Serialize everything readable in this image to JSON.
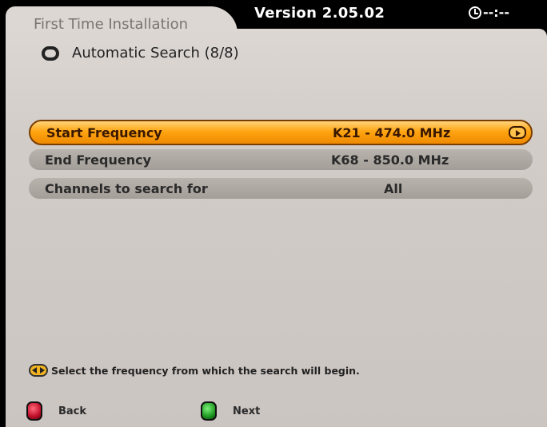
{
  "header": {
    "app_title": "First Time Installation",
    "version": "Version 2.05.02",
    "clock": "--:--"
  },
  "page": {
    "heading": "Automatic Search (8/8)",
    "heading_icon": "search-cycle-icon"
  },
  "settings": [
    {
      "label": "Start Frequency",
      "value": "K21 - 474.0 MHz",
      "selected": true,
      "icon": "right-arrow-icon"
    },
    {
      "label": "End Frequency",
      "value": "K68 - 850.0 MHz",
      "selected": false
    },
    {
      "label": "Channels to search for",
      "value": "All",
      "selected": false
    }
  ],
  "hint": {
    "icon": "left-right-arrows-icon",
    "text": "Select the frequency from which the search will begin."
  },
  "footer": {
    "back_label": "Back",
    "back_color": "#c1102a",
    "next_label": "Next",
    "next_color": "#1f9a22"
  },
  "colors": {
    "panel": "#d2ccc8",
    "highlight": "#ffa512",
    "row": "#a49e99",
    "header": "#000000"
  }
}
